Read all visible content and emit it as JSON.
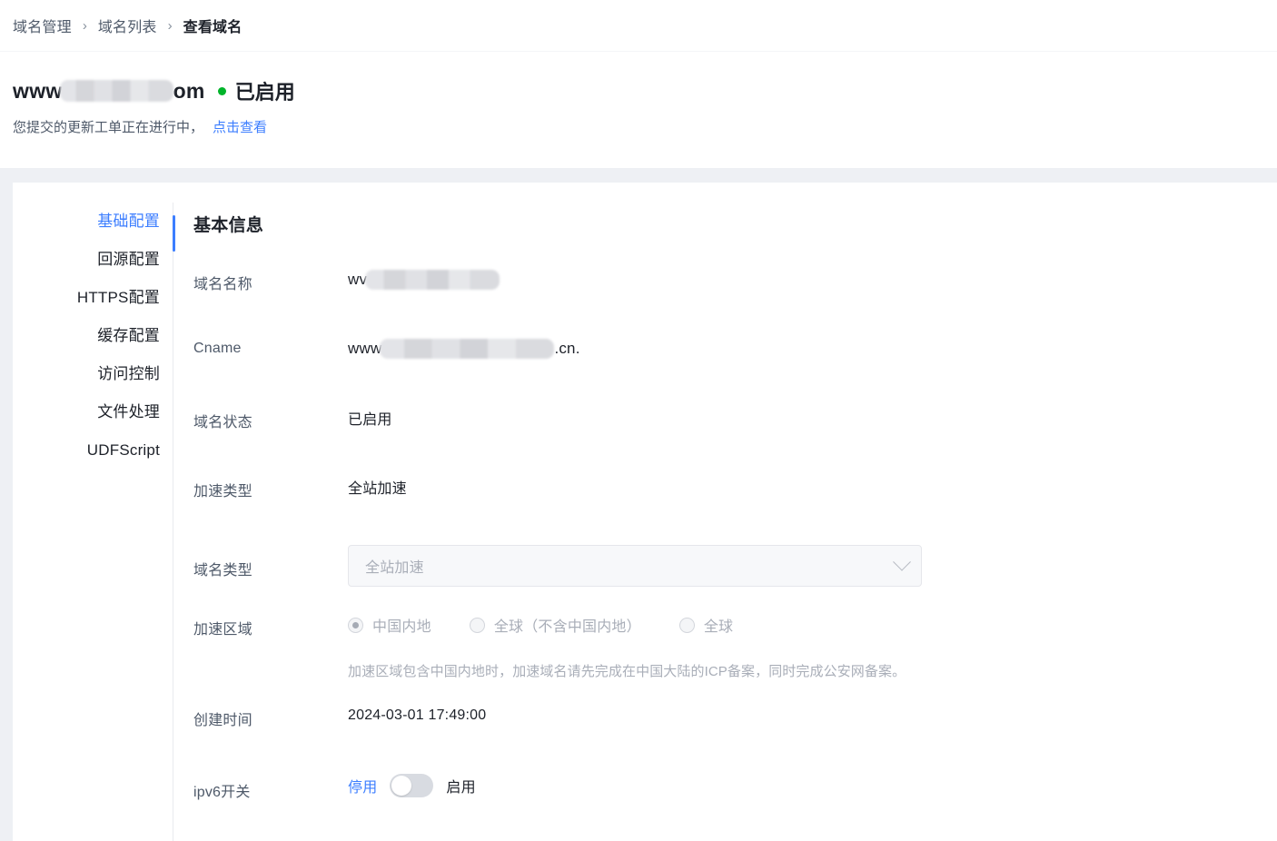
{
  "breadcrumb": {
    "items": [
      {
        "label": "域名管理",
        "current": false
      },
      {
        "label": "域名列表",
        "current": false
      },
      {
        "label": "查看域名",
        "current": true
      }
    ],
    "separator": "›"
  },
  "header": {
    "domain_prefix": "www",
    "domain_suffix": "om",
    "domain_redacted": true,
    "status_text": "已启用",
    "status_color": "#00b42a",
    "notice_text": "您提交的更新工单正在进行中，",
    "notice_link": "点击查看",
    "link_color": "#3c7eff"
  },
  "sidebar": {
    "items": [
      {
        "label": "基础配置",
        "active": true
      },
      {
        "label": "回源配置",
        "active": false
      },
      {
        "label": "HTTPS配置",
        "active": false
      },
      {
        "label": "缓存配置",
        "active": false
      },
      {
        "label": "访问控制",
        "active": false
      },
      {
        "label": "文件处理",
        "active": false
      },
      {
        "label": "UDFScript",
        "active": false
      }
    ],
    "active_indicator_color": "#3c7eff"
  },
  "main": {
    "section_title": "基本信息",
    "fields": {
      "domain_name": {
        "label": "域名名称",
        "prefix": "wv",
        "redacted": true
      },
      "cname": {
        "label": "Cname",
        "prefix": "www",
        "suffix": ".cn.",
        "redacted": true
      },
      "domain_status": {
        "label": "域名状态",
        "value": "已启用"
      },
      "accel_type": {
        "label": "加速类型",
        "value": "全站加速"
      },
      "domain_type": {
        "label": "域名类型",
        "selected": "全站加速",
        "options": [
          "全站加速"
        ],
        "disabled": true
      },
      "accel_region": {
        "label": "加速区域",
        "disabled": true,
        "options": [
          {
            "label": "中国内地",
            "checked": true
          },
          {
            "label": "全球（不含中国内地）",
            "checked": false
          },
          {
            "label": "全球",
            "checked": false
          }
        ],
        "helper": "加速区域包含中国内地时，加速域名请先完成在中国大陆的ICP备案，同时完成公安网备案。"
      },
      "create_time": {
        "label": "创建时间",
        "value": "2024-03-01 17:49:00"
      },
      "ipv6_switch": {
        "label": "ipv6开关",
        "off_label": "停用",
        "on_label": "启用",
        "enabled": false
      }
    }
  }
}
